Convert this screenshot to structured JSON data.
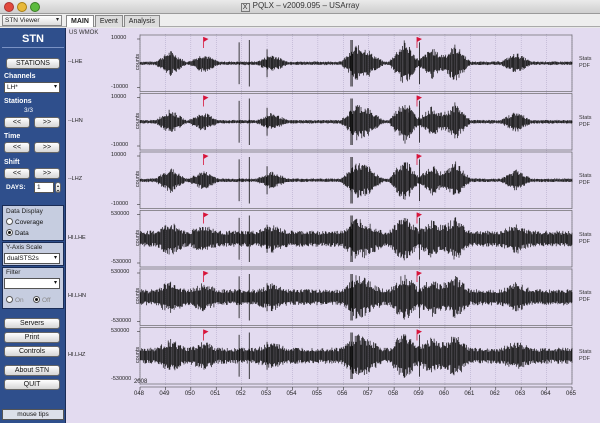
{
  "window": {
    "title": "PQLX – v2009.095 – USArray",
    "title_icon": "x-window-icon"
  },
  "menubar": {
    "viewer_select": "STN Viewer",
    "tabs": [
      {
        "label": "MAIN",
        "active": true
      },
      {
        "label": "Event",
        "active": false
      },
      {
        "label": "Analysis",
        "active": false
      }
    ]
  },
  "sidebar": {
    "title": "STN",
    "stations_button": "STATIONS",
    "channels": {
      "label": "Channels",
      "value": "LH*"
    },
    "stations": {
      "label": "Stations",
      "counter": "3/3",
      "prev": "<<",
      "next": ">>"
    },
    "time": {
      "label": "Time",
      "prev": "<<",
      "next": ">>"
    },
    "shift": {
      "label": "Shift",
      "prev": "<<",
      "next": ">>",
      "days_label": "DAYS:",
      "days_value": "1"
    },
    "data_display": {
      "label": "Data Display",
      "options": [
        {
          "label": "Coverage",
          "selected": false
        },
        {
          "label": "Data",
          "selected": true
        }
      ]
    },
    "yaxis_scale": {
      "label": "Y-Axis Scale",
      "value": "dualSTS2s"
    },
    "filter": {
      "label": "Filter",
      "value": "",
      "on_label": "On",
      "off_label": "Off"
    },
    "servers_button": "Servers",
    "print_button": "Print",
    "controls_button": "Controls",
    "about_button": "About STN",
    "quit_button": "QUIT",
    "mouse_tips": "mouse tips"
  },
  "plot": {
    "corner_label": "US WMOK",
    "ylabel": "counts",
    "x_year": "2008",
    "x_ticks": [
      "048",
      "049",
      "050",
      "051",
      "052",
      "053",
      "054",
      "055",
      "056",
      "057",
      "058",
      "059",
      "060",
      "061",
      "062",
      "063",
      "064",
      "065"
    ],
    "panels": [
      {
        "channel": "--LHE",
        "top": "10000",
        "bottom": "-10000",
        "stats": "Stats",
        "pdf": "PDF"
      },
      {
        "channel": "--LHN",
        "top": "10000",
        "bottom": "-10000",
        "stats": "Stats",
        "pdf": "PDF"
      },
      {
        "channel": "--LHZ",
        "top": "10000",
        "bottom": "-10000",
        "stats": "Stats",
        "pdf": "PDF"
      },
      {
        "channel": "HI.LHE",
        "top": "530000",
        "bottom": "-530000",
        "stats": "Stats",
        "pdf": "PDF"
      },
      {
        "channel": "HI.LHN",
        "top": "530000",
        "bottom": "-530000",
        "stats": "Stats",
        "pdf": "PDF"
      },
      {
        "channel": "HI.LHZ",
        "top": "530000",
        "bottom": "-530000",
        "stats": "Stats",
        "pdf": "PDF"
      }
    ]
  },
  "colors": {
    "sidebar_bg": "#2f4f8c",
    "plot_bg": "#e3dbf0",
    "trace": "#111111",
    "event_flag": "#d8143a"
  }
}
